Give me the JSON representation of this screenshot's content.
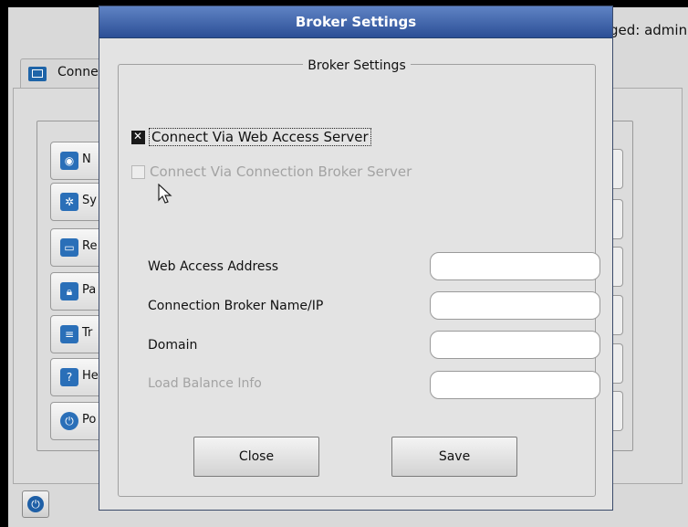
{
  "background": {
    "logged_in_text": "ged: admin",
    "tab_label": "Conne",
    "items": [
      {
        "label": "N",
        "icon": "globe-icon"
      },
      {
        "label": "Sy",
        "icon": "gear-icon"
      },
      {
        "label": "Re",
        "icon": "monitor-icon"
      },
      {
        "label": "Pa",
        "icon": "lock-icon"
      },
      {
        "label": "Tr",
        "icon": "printer-icon"
      },
      {
        "label": "He",
        "icon": "help-icon"
      },
      {
        "label": "Po",
        "icon": "power-icon"
      }
    ]
  },
  "dialog": {
    "title": "Broker Settings",
    "group_title": "Broker Settings",
    "options": [
      {
        "label": "Connect Via Web Access Server",
        "checked": true,
        "enabled": true
      },
      {
        "label": "Connect Via Connection Broker Server",
        "checked": false,
        "enabled": false
      }
    ],
    "fields": [
      {
        "label": "Web Access Address",
        "value": "",
        "enabled": true
      },
      {
        "label": "Connection Broker Name/IP",
        "value": "",
        "enabled": true
      },
      {
        "label": "Domain",
        "value": "",
        "enabled": true
      },
      {
        "label": "Load Balance Info",
        "value": "",
        "enabled": false
      }
    ],
    "close_label": "Close",
    "save_label": "Save"
  }
}
